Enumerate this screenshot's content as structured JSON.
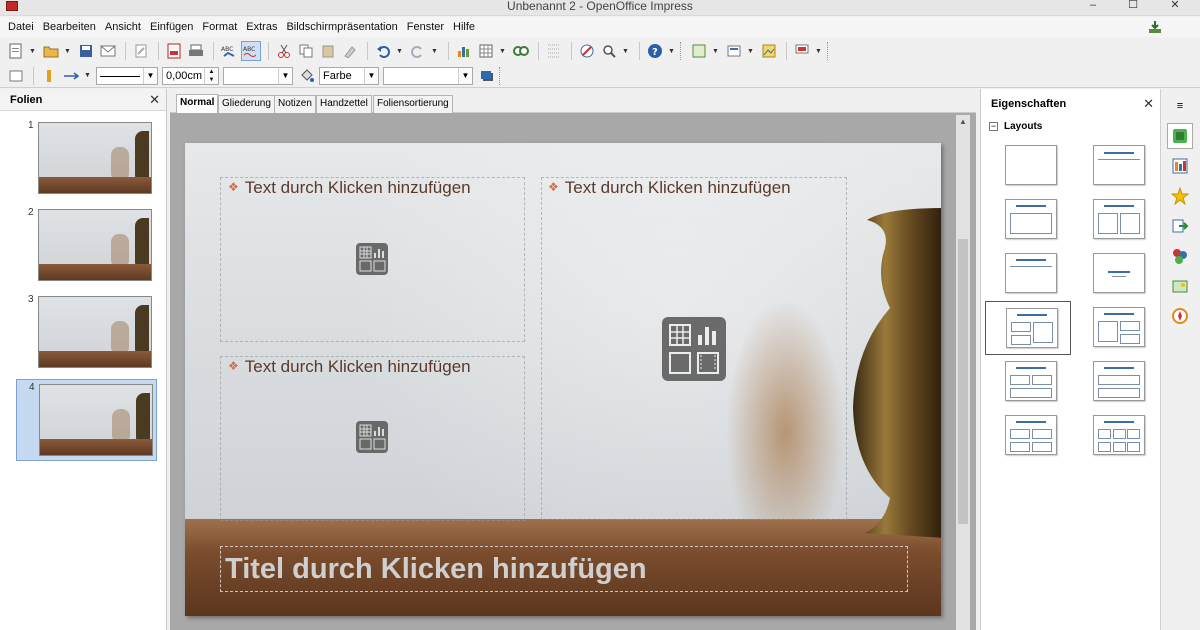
{
  "window": {
    "title": "Unbenannt 2 - OpenOffice Impress",
    "controls": [
      "–",
      "☐",
      "✕"
    ]
  },
  "menu": [
    "Datei",
    "Bearbeiten",
    "Ansicht",
    "Einfügen",
    "Format",
    "Extras",
    "Bildschirmpräsentation",
    "Fenster",
    "Hilfe"
  ],
  "toolbar2": {
    "line_width": "0,00cm",
    "fill_type": "Farbe",
    "line_style": "",
    "fill_value": ""
  },
  "slides_pane": {
    "title": "Folien",
    "close": "✕",
    "slides": [
      {
        "num": "1"
      },
      {
        "num": "2"
      },
      {
        "num": "3"
      },
      {
        "num": "4"
      }
    ],
    "selected": 4
  },
  "view_tabs": [
    "Normal",
    "Gliederung",
    "Notizen",
    "Handzettel",
    "Foliensortierung"
  ],
  "slide": {
    "placeholders": [
      "Text durch Klicken hinzufügen",
      "Text durch Klicken hinzufügen",
      "Text durch Klicken hinzufügen"
    ],
    "title_placeholder": "Titel durch Klicken hinzufügen"
  },
  "properties": {
    "title": "Eigenschaften",
    "close": "✕",
    "section": "Layouts",
    "section_toggle": "−",
    "layout_count": 12,
    "selected_layout": 7
  },
  "colors": {
    "accent_bar": "#3b6ea5",
    "selection": "#c5d9f0",
    "bullet": "#d0704a"
  }
}
